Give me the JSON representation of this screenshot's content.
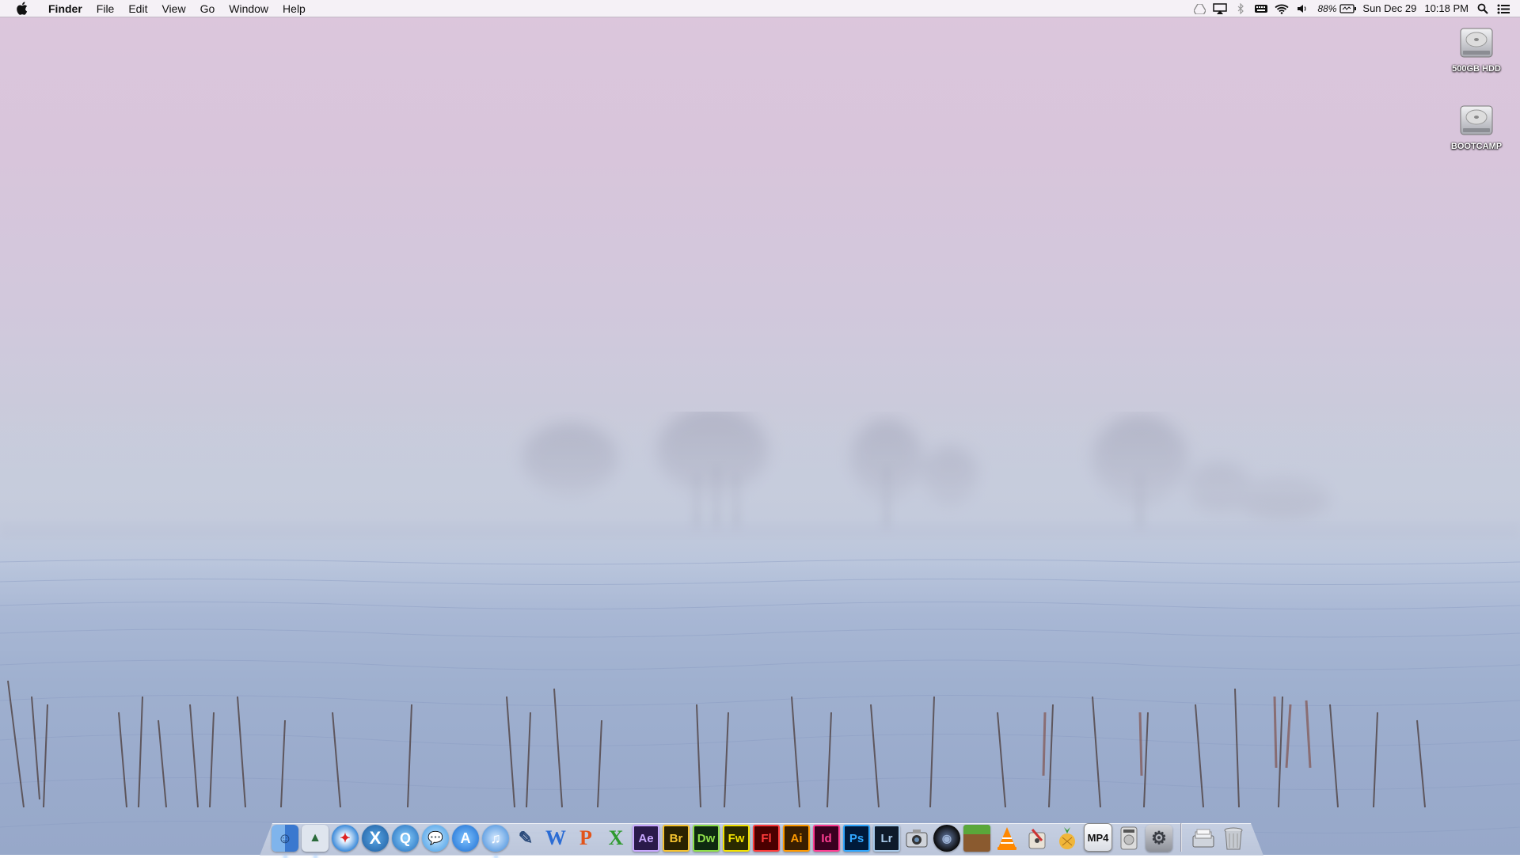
{
  "menubar": {
    "apple_icon": "apple-logo",
    "app_name": "Finder",
    "menus": [
      "File",
      "Edit",
      "View",
      "Go",
      "Window",
      "Help"
    ],
    "status_icons": [
      "google-drive-icon",
      "airplay-icon",
      "bluetooth-icon",
      "keyboard-icon",
      "wifi-icon",
      "volume-icon"
    ],
    "battery_percent": "88%",
    "date": "Sun Dec 29",
    "time": "10:18 PM",
    "right_icons": [
      "spotlight-icon",
      "notification-center-icon"
    ]
  },
  "desktop": {
    "icons": [
      {
        "label": "500GB HDD",
        "icon": "hard-drive-icon"
      },
      {
        "label": "BOOTCAMP",
        "icon": "hard-drive-icon"
      }
    ]
  },
  "dock": {
    "items": [
      {
        "name": "finder",
        "icon": "finder-icon",
        "running": true
      },
      {
        "name": "preview",
        "icon": "preview-icon",
        "running": true
      },
      {
        "name": "safari",
        "icon": "safari-icon",
        "running": false
      },
      {
        "name": "mac-os-x",
        "icon": "os-x-icon",
        "text": "X",
        "running": false
      },
      {
        "name": "quicktime",
        "icon": "quicktime-icon",
        "running": false
      },
      {
        "name": "messages",
        "icon": "messages-icon",
        "running": false
      },
      {
        "name": "app-store",
        "icon": "app-store-icon",
        "running": false
      },
      {
        "name": "itunes",
        "icon": "itunes-icon",
        "running": true
      },
      {
        "name": "script-editor",
        "icon": "script-icon",
        "running": false
      },
      {
        "name": "word",
        "icon": "word-icon",
        "text": "W",
        "running": false
      },
      {
        "name": "powerpoint",
        "icon": "powerpoint-icon",
        "text": "P",
        "running": false
      },
      {
        "name": "excel",
        "icon": "excel-icon",
        "text": "X",
        "running": false
      },
      {
        "name": "after-effects",
        "icon": "after-effects-icon",
        "text": "Ae",
        "running": false
      },
      {
        "name": "bridge",
        "icon": "bridge-icon",
        "text": "Br",
        "running": false
      },
      {
        "name": "dreamweaver",
        "icon": "dreamweaver-icon",
        "text": "Dw",
        "running": false
      },
      {
        "name": "fireworks",
        "icon": "fireworks-icon",
        "text": "Fw",
        "running": false
      },
      {
        "name": "flash",
        "icon": "flash-icon",
        "text": "Fl",
        "running": false
      },
      {
        "name": "illustrator",
        "icon": "illustrator-icon",
        "text": "Ai",
        "running": false
      },
      {
        "name": "indesign",
        "icon": "indesign-icon",
        "text": "Id",
        "running": false
      },
      {
        "name": "photoshop",
        "icon": "photoshop-icon",
        "text": "Ps",
        "running": false
      },
      {
        "name": "lightroom",
        "icon": "lightroom-icon",
        "text": "Lr",
        "running": false
      },
      {
        "name": "image-capture",
        "icon": "camera-icon",
        "running": false
      },
      {
        "name": "aperture",
        "icon": "aperture-icon",
        "running": false
      },
      {
        "name": "minecraft",
        "icon": "minecraft-icon",
        "running": false
      },
      {
        "name": "vlc",
        "icon": "vlc-icon",
        "running": false
      },
      {
        "name": "utility",
        "icon": "utility-icon",
        "running": false
      },
      {
        "name": "fruit-app",
        "icon": "pineapple-icon",
        "running": false
      },
      {
        "name": "mp4-tools",
        "icon": "mp4-icon",
        "text": "MP4",
        "running": false
      },
      {
        "name": "dvd-player",
        "icon": "dvd-icon",
        "running": false
      },
      {
        "name": "system-preferences",
        "icon": "gear-icon",
        "running": false
      }
    ],
    "right_items": [
      {
        "name": "downloads-stack",
        "icon": "stack-icon"
      },
      {
        "name": "trash",
        "icon": "trash-icon"
      }
    ]
  }
}
